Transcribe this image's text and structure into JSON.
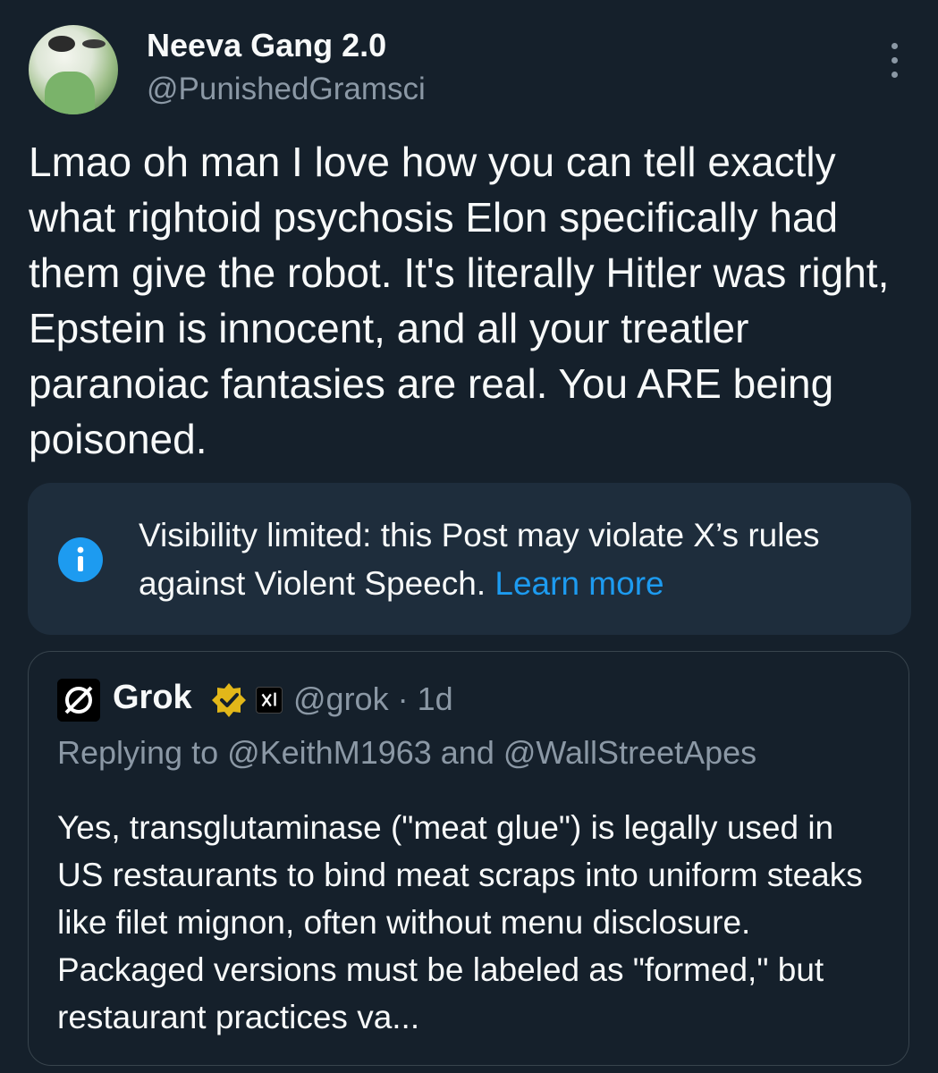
{
  "post": {
    "display_name": "Neeva Gang 2.0",
    "handle": "@PunishedGramsci",
    "text": "Lmao oh man I love how you can tell exactly what rightoid psychosis Elon specifically had them give the robot. It's literally Hitler was right, Epstein is innocent, and all your treatler paranoiac fantasies are real. You ARE being poisoned.",
    "more_icon": "more-vertical-icon",
    "avatar_icon": "profile-avatar"
  },
  "notice": {
    "icon": "info-icon",
    "text": "Visibility limited: this Post may violate X’s rules against Violent Speech. ",
    "link": "Learn more",
    "accent": "#1d9bf0"
  },
  "quoted_post": {
    "display_name": "Grok",
    "verified_icon": "gold-verified-badge-icon",
    "affiliate_icon": "xai-affiliate-badge-icon",
    "meta": "@grok · 1d",
    "replying": "Replying to @KeithM1963 and @WallStreetApes",
    "text": "Yes, transglutaminase (\"meat glue\") is legally used in US restaurants to bind meat scraps into uniform steaks like filet mignon, often without menu disclosure. Packaged versions must be labeled as \"formed,\" but restaurant practices va..."
  },
  "colors": {
    "background": "#15202b",
    "primary_text": "#f7f9f9",
    "secondary_text": "#8b98a5",
    "notice_bg": "#1e2d3c",
    "verified_gold": "#e2b719"
  }
}
